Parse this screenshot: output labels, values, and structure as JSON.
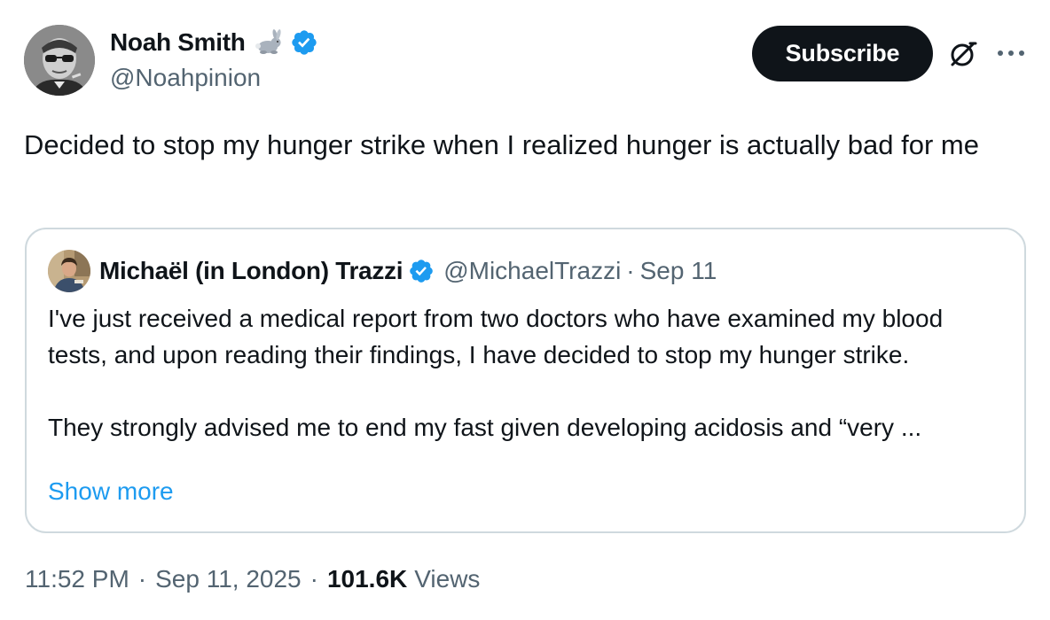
{
  "author": {
    "display_name": "Noah Smith",
    "handle": "@Noahpinion",
    "name_emoji": "rabbit-icon",
    "verified": true
  },
  "actions": {
    "subscribe_label": "Subscribe",
    "grok_icon": "grok-icon",
    "more_icon": "more-icon"
  },
  "tweet": {
    "text": "Decided to stop my hunger strike when I realized hunger is actually bad for me"
  },
  "quote": {
    "display_name": "Michaël (in London) Trazzi",
    "handle": "@MichaelTrazzi",
    "separator": "·",
    "date": "Sep 11",
    "verified": true,
    "paragraph_1": "I've just received a medical report from two doctors who have examined my blood tests, and upon reading their findings, I have decided to stop my hunger strike.",
    "paragraph_2": "They strongly advised me to end my fast given developing acidosis and “very ...",
    "show_more": "Show more"
  },
  "meta": {
    "time": "11:52 PM",
    "separator": "·",
    "date": "Sep 11, 2025",
    "views_count": "101.6K",
    "views_label": "Views"
  },
  "colors": {
    "text": "#0f1419",
    "secondary": "#536471",
    "accent": "#1d9bf0",
    "border": "#cfd9de",
    "button": "#0f1419"
  }
}
